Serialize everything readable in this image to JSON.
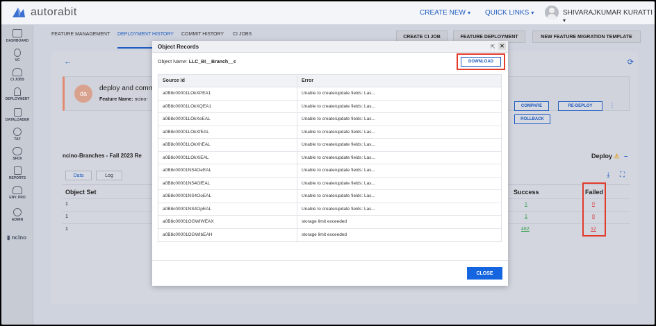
{
  "app": {
    "logo_text": "autorabit"
  },
  "topnav": {
    "create_new": "CREATE NEW",
    "quick_links": "QUICK LINKS",
    "user_name": "SHIVARAJKUMAR KURATTI"
  },
  "sidebar": {
    "items": [
      {
        "label": "DASHBOARD",
        "icon": "dashboard-icon"
      },
      {
        "label": "VC",
        "icon": "version-control-icon"
      },
      {
        "label": "CI JOBS",
        "icon": "ci-jobs-icon"
      },
      {
        "label": "DEPLOYMENT",
        "icon": "deployment-icon"
      },
      {
        "label": "DATALOADER",
        "icon": "dataloader-icon"
      },
      {
        "label": "TAF",
        "icon": "taf-icon"
      },
      {
        "label": "SFDX",
        "icon": "sfdx-icon"
      },
      {
        "label": "REPORTS",
        "icon": "reports-icon"
      },
      {
        "label": "ENV. PRO",
        "icon": "env-pro-icon"
      },
      {
        "label": "ADMIN",
        "icon": "admin-icon"
      }
    ],
    "ncino_label": "ncino"
  },
  "tabs": {
    "feature_management": "FEATURE MANAGEMENT",
    "deployment_history": "DEPLOYMENT HISTORY",
    "commit_history": "COMMIT HISTORY",
    "ci_jobs": "CI JOBS"
  },
  "header_buttons": {
    "create_ci_job": "CREATE CI JOB",
    "feature_deployment": "FEATURE DEPLOYMENT",
    "new_feature_migration": "NEW FEATURE MIGRATION TEMPLATE"
  },
  "deployment": {
    "avatar_initials": "da",
    "title": "deploy and commi",
    "feature_label": "Feature Name:",
    "feature_value": "ncino-",
    "compare": "COMPARE",
    "redeploy": "RE-DEPLOY",
    "rollback": "ROLLBACK",
    "branch_title": "ncino-Branches - Fall 2023 Re",
    "status": "Deploy",
    "status_icon": "warning-icon"
  },
  "subtabs": {
    "data": "Data",
    "log": "Log"
  },
  "grid": {
    "headers": {
      "object_set": "Object Set",
      "success": "Success",
      "failed": "Failed"
    },
    "rows": [
      {
        "object_set": "1",
        "success": "1",
        "failed": "0"
      },
      {
        "object_set": "1",
        "success": "1",
        "failed": "0"
      },
      {
        "object_set": "1",
        "success": "462",
        "failed": "12"
      }
    ]
  },
  "modal": {
    "title": "Object Records",
    "object_name_label": "Object Name:",
    "object_name_value": "LLC_BI__Branch__c",
    "download": "DOWNLOAD",
    "close": "CLOSE",
    "columns": {
      "source_id": "Source Id",
      "error": "Error"
    },
    "records": [
      {
        "id": "a0B8c00001LOkXPEA1",
        "error": "Unable to create/update fields: Las..."
      },
      {
        "id": "a0B8c00001LOkXQEA1",
        "error": "Unable to create/update fields: Las..."
      },
      {
        "id": "a0B8c00001LOkXeEAL",
        "error": "Unable to create/update fields: Las..."
      },
      {
        "id": "a0B8c00001LOkXfEAL",
        "error": "Unable to create/update fields: Las..."
      },
      {
        "id": "a0B8c00001LOkXhEAL",
        "error": "Unable to create/update fields: Las..."
      },
      {
        "id": "a0B8c00001LOkXiEAL",
        "error": "Unable to create/update fields: Las..."
      },
      {
        "id": "a0B8c00001NS4OeEAL",
        "error": "Unable to create/update fields: Las..."
      },
      {
        "id": "a0B8c00001NS4OfEAL",
        "error": "Unable to create/update fields: Las..."
      },
      {
        "id": "a0B8c00001NS4OoEAL",
        "error": "Unable to create/update fields: Las..."
      },
      {
        "id": "a0B8c00001NS4OpEAL",
        "error": "Unable to create/update fields: Las..."
      },
      {
        "id": "a0B8c00001OGWIWEAX",
        "error": "storage limit exceeded"
      },
      {
        "id": "a0B8c00001OGWIbEAH",
        "error": "storage limit exceeded"
      }
    ]
  },
  "colors": {
    "accent": "#1e5bbf",
    "highlight_red": "#e23b2e",
    "success_green": "#2f9e44",
    "failed_red": "#d63b3b"
  }
}
